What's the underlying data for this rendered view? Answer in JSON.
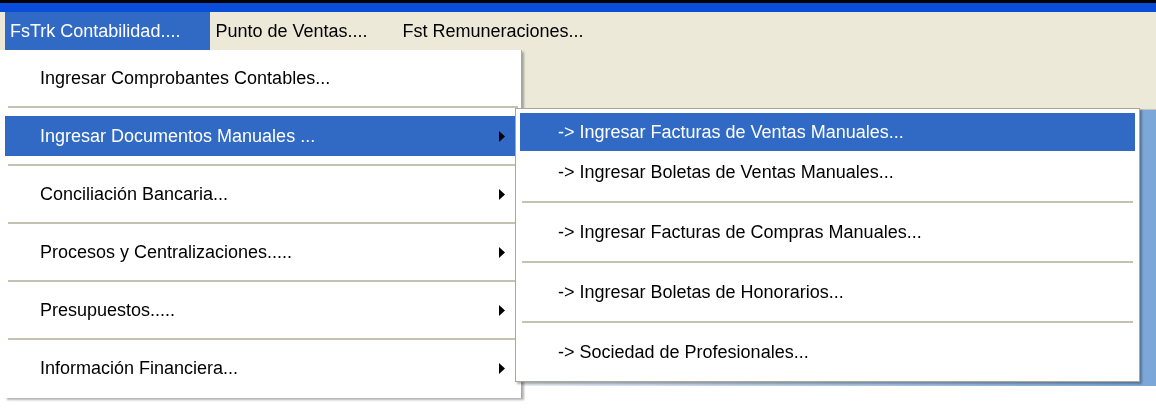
{
  "menubar": [
    {
      "label": "FsTrk Contabilidad....",
      "selected": true
    },
    {
      "label": "Punto de Ventas....",
      "selected": false
    },
    {
      "label": "Fst Remuneraciones...",
      "selected": false
    }
  ],
  "menu": {
    "items": [
      {
        "label": "Ingresar Comprobantes Contables...",
        "selected": false,
        "has_submenu": false
      },
      {
        "label": "Ingresar Documentos Manuales ...",
        "selected": true,
        "has_submenu": true
      },
      {
        "label": "Conciliación Bancaria...",
        "selected": false,
        "has_submenu": true
      },
      {
        "label": "Procesos y Centralizaciones.....",
        "selected": false,
        "has_submenu": true
      },
      {
        "label": "Presupuestos.....",
        "selected": false,
        "has_submenu": true
      },
      {
        "label": "Información Financiera...",
        "selected": false,
        "has_submenu": true
      }
    ]
  },
  "submenu": {
    "items": [
      {
        "label": "-> Ingresar Facturas de Ventas Manuales...",
        "selected": true,
        "separator_after": false
      },
      {
        "label": "-> Ingresar Boletas de Ventas Manuales...",
        "selected": false,
        "separator_after": true
      },
      {
        "label": "-> Ingresar Facturas de Compras Manuales...",
        "selected": false,
        "separator_after": true
      },
      {
        "label": "-> Ingresar Boletas de Honorarios...",
        "selected": false,
        "separator_after": true
      },
      {
        "label": "-> Sociedad de Profesionales...",
        "selected": false,
        "separator_after": false
      }
    ]
  }
}
